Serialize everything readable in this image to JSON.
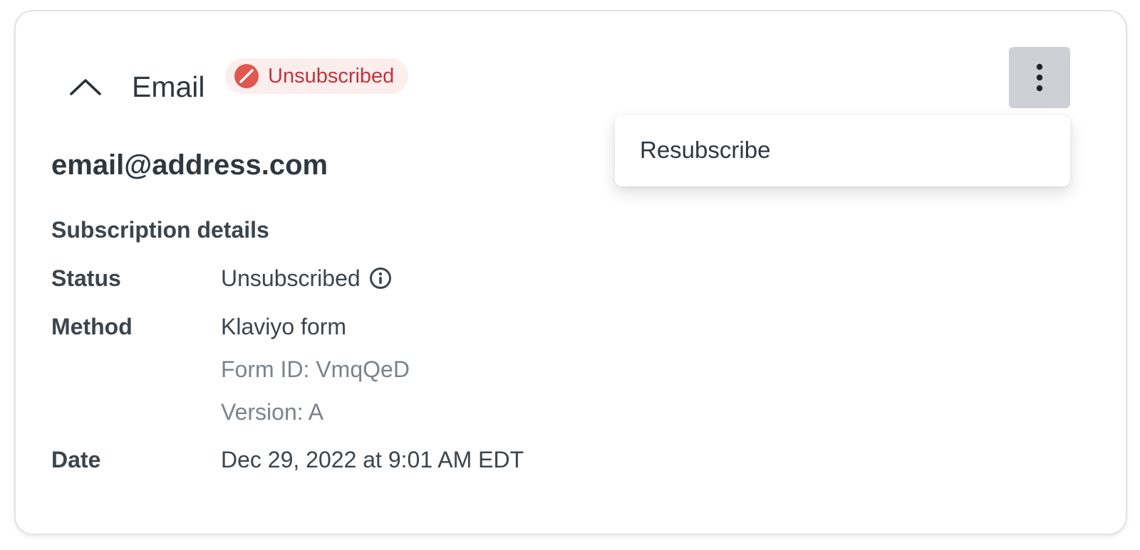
{
  "channel": {
    "title": "Email",
    "status_badge": "Unsubscribed",
    "collapse_icon": "chevron-up-icon",
    "badge_icon": "prohibited-icon",
    "menu_icon": "kebab-vertical-icon"
  },
  "menu": {
    "items": [
      {
        "label": "Resubscribe"
      }
    ]
  },
  "profile": {
    "email": "email@address.com"
  },
  "details": {
    "heading": "Subscription details",
    "status": {
      "label": "Status",
      "value": "Unsubscribed",
      "icon": "info-icon"
    },
    "method": {
      "label": "Method",
      "value": "Klaviyo form",
      "form_id": "Form ID: VmqQeD",
      "version": "Version: A"
    },
    "date": {
      "label": "Date",
      "value": "Dec 29, 2022 at 9:01 AM EDT"
    }
  },
  "colors": {
    "badge_bg": "#fdeeee",
    "badge_text": "#c2343c",
    "badge_icon": "#e0574f",
    "menu_button_bg": "#cdd1d6",
    "text_primary": "#2f3840",
    "text_muted": "#7b838b"
  }
}
